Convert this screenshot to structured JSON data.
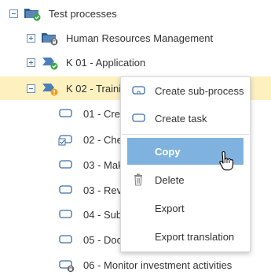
{
  "tree": {
    "items": [
      {
        "label": "Test processes",
        "expander": "minus",
        "icon": "folder-check-icon"
      },
      {
        "label": "Human Resources Management",
        "expander": "plus",
        "icon": "folder-lock-icon"
      },
      {
        "label": "K 01 - Application",
        "expander": "plus",
        "icon": "process-check-icon"
      },
      {
        "label": "K 02 - Trainin",
        "expander": "minus",
        "icon": "process-warning-icon"
      },
      {
        "label": "01 - Crea",
        "expander": "none",
        "icon": "task-icon"
      },
      {
        "label": "02 - Chec",
        "expander": "none",
        "icon": "task-check-icon"
      },
      {
        "label": "03 - Mak",
        "expander": "none",
        "icon": "task-icon"
      },
      {
        "label": "03 - Revi",
        "expander": "none",
        "icon": "task-icon"
      },
      {
        "label": "04 - Subr",
        "expander": "none",
        "icon": "task-icon"
      },
      {
        "label": "05 - Docu",
        "expander": "none",
        "icon": "task-icon"
      },
      {
        "label": "06 - Monitor investment activities",
        "expander": "none",
        "icon": "task-lock-icon"
      }
    ]
  },
  "context_menu": {
    "items": [
      {
        "label": "Create sub-process",
        "icon": "subprocess-icon"
      },
      {
        "label": "Create task",
        "icon": "task-icon"
      },
      {
        "label": "Copy",
        "icon": "",
        "state": "hover"
      },
      {
        "label": "Delete",
        "icon": "trash-icon"
      },
      {
        "label": "Export",
        "icon": ""
      },
      {
        "label": "Export translation",
        "icon": ""
      }
    ]
  },
  "colors": {
    "selected_row": "#fdf1c0",
    "menu_hover": "#7fb2de",
    "icon_blue": "#3b6ea5",
    "badge_green": "#3aa84a",
    "badge_orange": "#f0a020",
    "badge_gray": "#666666"
  }
}
